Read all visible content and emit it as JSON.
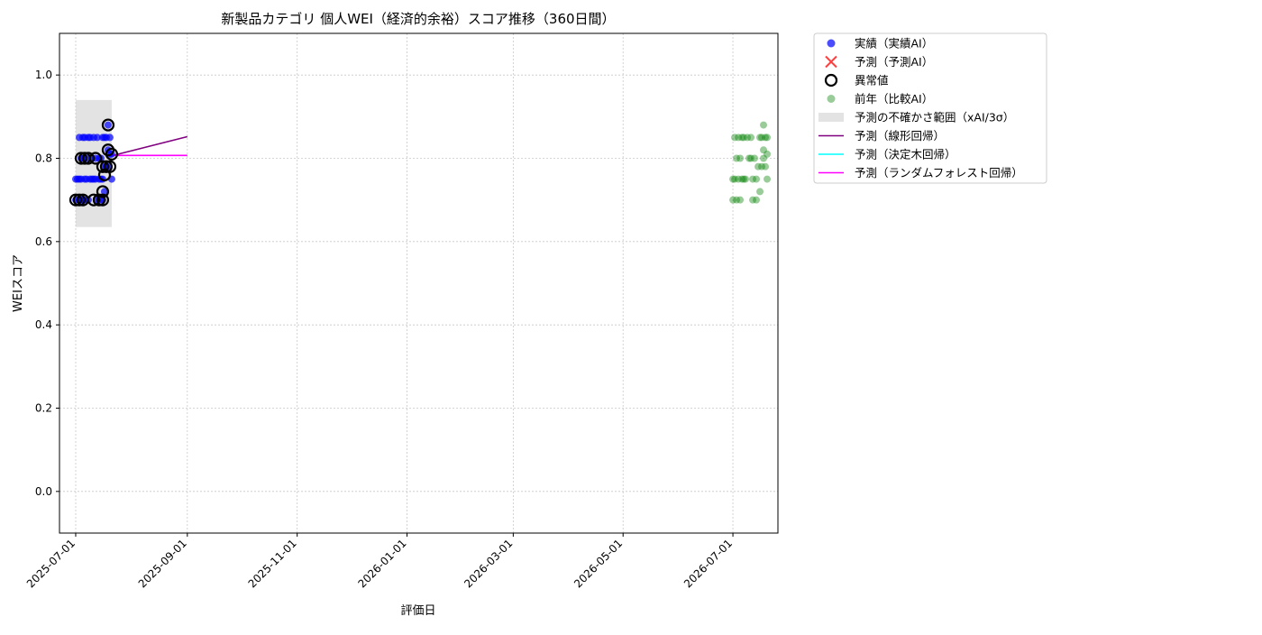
{
  "chart_data": {
    "type": "scatter",
    "title": "新製品カテゴリ 個人WEI（経済的余裕）スコア推移（360日間）",
    "xlabel": "評価日",
    "ylabel": "WEIスコア",
    "xlim": [
      "2025-06-22",
      "2026-07-26"
    ],
    "ylim": [
      -0.1,
      1.1
    ],
    "yticks": [
      0.0,
      0.2,
      0.4,
      0.6,
      0.8,
      1.0
    ],
    "ytick_labels": [
      "0.0",
      "0.2",
      "0.4",
      "0.6",
      "0.8",
      "1.0"
    ],
    "xticks": [
      "2025-07-01",
      "2025-09-01",
      "2025-11-01",
      "2026-01-01",
      "2026-03-01",
      "2026-05-01",
      "2026-07-01"
    ],
    "xtick_labels": [
      "2025-07-01",
      "2025-09-01",
      "2025-11-01",
      "2026-01-01",
      "2026-03-01",
      "2026-05-01",
      "2026-07-01"
    ],
    "grid": true,
    "legend_position": "outside-upper-right",
    "legend": [
      {
        "label": "実績（実績AI）",
        "marker": "dot",
        "color": "#0000ff"
      },
      {
        "label": "予測（予測AI）",
        "marker": "x",
        "color": "#ff0000"
      },
      {
        "label": "異常値",
        "marker": "ring",
        "color": "#000000"
      },
      {
        "label": "前年（比較AI）",
        "marker": "dot",
        "color": "#008000"
      },
      {
        "label": "予測の不確かさ範囲（xAI/3σ）",
        "marker": "band",
        "color": "#cccccc"
      },
      {
        "label": "予測（線形回帰）",
        "marker": "line",
        "color": "#800080"
      },
      {
        "label": "予測（決定木回帰）",
        "marker": "line",
        "color": "#00ffff"
      },
      {
        "label": "予測（ランダムフォレスト回帰）",
        "marker": "line",
        "color": "#ff00ff"
      }
    ],
    "series": [
      {
        "name": "実績（実績AI）",
        "color": "#0000ff",
        "points": [
          [
            "2025-07-01",
            0.7
          ],
          [
            "2025-07-01",
            0.75
          ],
          [
            "2025-07-02",
            0.75
          ],
          [
            "2025-07-03",
            0.7
          ],
          [
            "2025-07-03",
            0.75
          ],
          [
            "2025-07-03",
            0.85
          ],
          [
            "2025-07-04",
            0.7
          ],
          [
            "2025-07-04",
            0.8
          ],
          [
            "2025-07-04",
            0.75
          ],
          [
            "2025-07-05",
            0.7
          ],
          [
            "2025-07-05",
            0.8
          ],
          [
            "2025-07-05",
            0.85
          ],
          [
            "2025-07-06",
            0.7
          ],
          [
            "2025-07-06",
            0.75
          ],
          [
            "2025-07-06",
            0.85
          ],
          [
            "2025-07-07",
            0.75
          ],
          [
            "2025-07-07",
            0.8
          ],
          [
            "2025-07-08",
            0.7
          ],
          [
            "2025-07-08",
            0.85
          ],
          [
            "2025-07-09",
            0.75
          ],
          [
            "2025-07-09",
            0.85
          ],
          [
            "2025-07-10",
            0.75
          ],
          [
            "2025-07-10",
            0.8
          ],
          [
            "2025-07-11",
            0.75
          ],
          [
            "2025-07-11",
            0.85
          ],
          [
            "2025-07-12",
            0.75
          ],
          [
            "2025-07-12",
            0.8
          ],
          [
            "2025-07-13",
            0.7
          ],
          [
            "2025-07-13",
            0.85
          ],
          [
            "2025-07-14",
            0.75
          ],
          [
            "2025-07-14",
            0.8
          ],
          [
            "2025-07-15",
            0.7
          ],
          [
            "2025-07-15",
            0.75
          ],
          [
            "2025-07-15",
            0.8
          ],
          [
            "2025-07-16",
            0.7
          ],
          [
            "2025-07-16",
            0.75
          ],
          [
            "2025-07-16",
            0.85
          ],
          [
            "2025-07-17",
            0.72
          ],
          [
            "2025-07-17",
            0.78
          ],
          [
            "2025-07-17",
            0.85
          ],
          [
            "2025-07-18",
            0.78
          ],
          [
            "2025-07-18",
            0.85
          ],
          [
            "2025-07-19",
            0.82
          ],
          [
            "2025-07-19",
            0.88
          ],
          [
            "2025-07-19",
            0.78
          ],
          [
            "2025-07-20",
            0.85
          ],
          [
            "2025-07-20",
            0.81
          ],
          [
            "2025-07-21",
            0.81
          ],
          [
            "2025-07-21",
            0.75
          ]
        ]
      },
      {
        "name": "異常値",
        "color": "#000000",
        "points": [
          [
            "2025-07-01",
            0.7
          ],
          [
            "2025-07-03",
            0.7
          ],
          [
            "2025-07-04",
            0.8
          ],
          [
            "2025-07-05",
            0.7
          ],
          [
            "2025-07-06",
            0.8
          ],
          [
            "2025-07-08",
            0.8
          ],
          [
            "2025-07-11",
            0.7
          ],
          [
            "2025-07-12",
            0.8
          ],
          [
            "2025-07-14",
            0.7
          ],
          [
            "2025-07-16",
            0.7
          ],
          [
            "2025-07-16",
            0.72
          ],
          [
            "2025-07-16",
            0.78
          ],
          [
            "2025-07-17",
            0.76
          ],
          [
            "2025-07-18",
            0.78
          ],
          [
            "2025-07-19",
            0.88
          ],
          [
            "2025-07-19",
            0.82
          ],
          [
            "2025-07-20",
            0.78
          ],
          [
            "2025-07-21",
            0.81
          ]
        ]
      },
      {
        "name": "前年（比較AI）",
        "color": "#008000",
        "points": [
          [
            "2026-07-01",
            0.7
          ],
          [
            "2026-07-01",
            0.75
          ],
          [
            "2026-07-02",
            0.85
          ],
          [
            "2026-07-02",
            0.75
          ],
          [
            "2026-07-03",
            0.7
          ],
          [
            "2026-07-03",
            0.8
          ],
          [
            "2026-07-04",
            0.85
          ],
          [
            "2026-07-04",
            0.75
          ],
          [
            "2026-07-05",
            0.8
          ],
          [
            "2026-07-05",
            0.7
          ],
          [
            "2026-07-06",
            0.85
          ],
          [
            "2026-07-06",
            0.75
          ],
          [
            "2026-07-07",
            0.75
          ],
          [
            "2026-07-07",
            0.85
          ],
          [
            "2026-07-08",
            0.75
          ],
          [
            "2026-07-09",
            0.85
          ],
          [
            "2026-07-10",
            0.8
          ],
          [
            "2026-07-11",
            0.8
          ],
          [
            "2026-07-11",
            0.85
          ],
          [
            "2026-07-12",
            0.7
          ],
          [
            "2026-07-12",
            0.75
          ],
          [
            "2026-07-13",
            0.8
          ],
          [
            "2026-07-14",
            0.75
          ],
          [
            "2026-07-14",
            0.7
          ],
          [
            "2026-07-15",
            0.78
          ],
          [
            "2026-07-16",
            0.72
          ],
          [
            "2026-07-16",
            0.85
          ],
          [
            "2026-07-17",
            0.78
          ],
          [
            "2026-07-17",
            0.85
          ],
          [
            "2026-07-18",
            0.88
          ],
          [
            "2026-07-18",
            0.82
          ],
          [
            "2026-07-18",
            0.8
          ],
          [
            "2026-07-19",
            0.78
          ],
          [
            "2026-07-19",
            0.85
          ],
          [
            "2026-07-20",
            0.81
          ],
          [
            "2026-07-20",
            0.75
          ],
          [
            "2026-07-20",
            0.85
          ]
        ]
      }
    ],
    "uncertainty_band": {
      "x": [
        "2025-07-01",
        "2025-07-21"
      ],
      "y": [
        0.635,
        0.94
      ],
      "color": "#cccccc"
    },
    "prediction_lines": [
      {
        "name": "予測（線形回帰）",
        "color": "#800080",
        "x": [
          "2025-07-21",
          "2025-09-01"
        ],
        "y": [
          0.806,
          0.852
        ]
      },
      {
        "name": "予測（ランダムフォレスト回帰）",
        "color": "#ff00ff",
        "x": [
          "2025-07-21",
          "2025-09-01"
        ],
        "y": [
          0.807,
          0.807
        ]
      }
    ]
  }
}
